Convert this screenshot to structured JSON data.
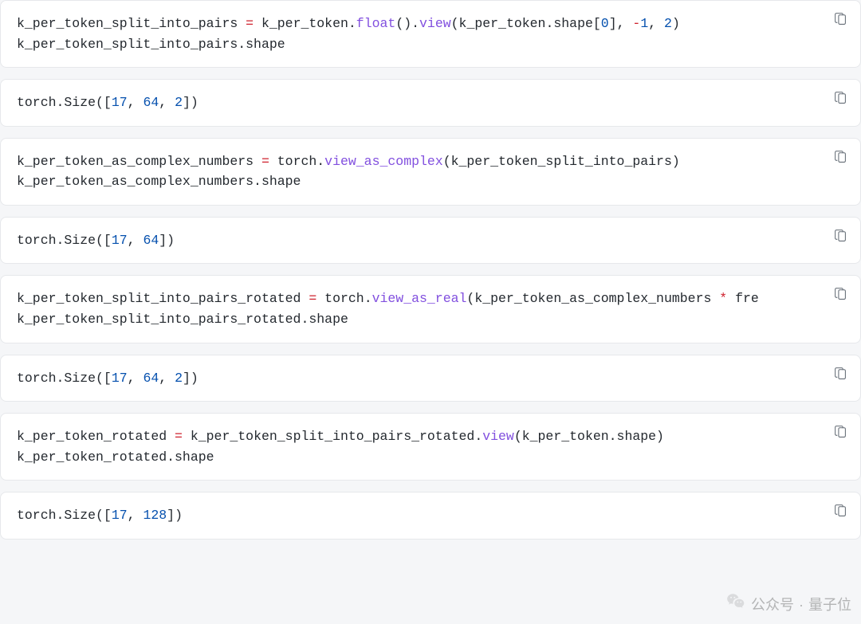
{
  "cells": [
    {
      "type": "code",
      "tokens": [
        {
          "t": "k_per_token_split_into_pairs ",
          "c": "id"
        },
        {
          "t": "=",
          "c": "op"
        },
        {
          "t": " k_per_token.",
          "c": "id"
        },
        {
          "t": "float",
          "c": "fn"
        },
        {
          "t": "().",
          "c": "id"
        },
        {
          "t": "view",
          "c": "fn"
        },
        {
          "t": "(k_per_token.shape[",
          "c": "id"
        },
        {
          "t": "0",
          "c": "num"
        },
        {
          "t": "], ",
          "c": "id"
        },
        {
          "t": "-",
          "c": "op"
        },
        {
          "t": "1",
          "c": "num"
        },
        {
          "t": ", ",
          "c": "id"
        },
        {
          "t": "2",
          "c": "num"
        },
        {
          "t": ")\n",
          "c": "id"
        },
        {
          "t": "k_per_token_split_into_pairs.shape",
          "c": "id"
        }
      ]
    },
    {
      "type": "output",
      "tokens": [
        {
          "t": "torch.Size([",
          "c": "id"
        },
        {
          "t": "17",
          "c": "num"
        },
        {
          "t": ", ",
          "c": "id"
        },
        {
          "t": "64",
          "c": "num"
        },
        {
          "t": ", ",
          "c": "id"
        },
        {
          "t": "2",
          "c": "num"
        },
        {
          "t": "])",
          "c": "id"
        }
      ]
    },
    {
      "type": "code",
      "tokens": [
        {
          "t": "k_per_token_as_complex_numbers ",
          "c": "id"
        },
        {
          "t": "=",
          "c": "op"
        },
        {
          "t": " torch.",
          "c": "id"
        },
        {
          "t": "view_as_complex",
          "c": "fn"
        },
        {
          "t": "(k_per_token_split_into_pairs)\n",
          "c": "id"
        },
        {
          "t": "k_per_token_as_complex_numbers.shape",
          "c": "id"
        }
      ]
    },
    {
      "type": "output",
      "tokens": [
        {
          "t": "torch.Size([",
          "c": "id"
        },
        {
          "t": "17",
          "c": "num"
        },
        {
          "t": ", ",
          "c": "id"
        },
        {
          "t": "64",
          "c": "num"
        },
        {
          "t": "])",
          "c": "id"
        }
      ]
    },
    {
      "type": "code",
      "tokens": [
        {
          "t": "k_per_token_split_into_pairs_rotated ",
          "c": "id"
        },
        {
          "t": "=",
          "c": "op"
        },
        {
          "t": " torch.",
          "c": "id"
        },
        {
          "t": "view_as_real",
          "c": "fn"
        },
        {
          "t": "(k_per_token_as_complex_numbers ",
          "c": "id"
        },
        {
          "t": "*",
          "c": "op"
        },
        {
          "t": " fre\n",
          "c": "id"
        },
        {
          "t": "k_per_token_split_into_pairs_rotated.shape",
          "c": "id"
        }
      ]
    },
    {
      "type": "output",
      "tokens": [
        {
          "t": "torch.Size([",
          "c": "id"
        },
        {
          "t": "17",
          "c": "num"
        },
        {
          "t": ", ",
          "c": "id"
        },
        {
          "t": "64",
          "c": "num"
        },
        {
          "t": ", ",
          "c": "id"
        },
        {
          "t": "2",
          "c": "num"
        },
        {
          "t": "])",
          "c": "id"
        }
      ]
    },
    {
      "type": "code",
      "tokens": [
        {
          "t": "k_per_token_rotated ",
          "c": "id"
        },
        {
          "t": "=",
          "c": "op"
        },
        {
          "t": " k_per_token_split_into_pairs_rotated.",
          "c": "id"
        },
        {
          "t": "view",
          "c": "fn"
        },
        {
          "t": "(k_per_token.shape)\n",
          "c": "id"
        },
        {
          "t": "k_per_token_rotated.shape",
          "c": "id"
        }
      ]
    },
    {
      "type": "output",
      "tokens": [
        {
          "t": "torch.Size([",
          "c": "id"
        },
        {
          "t": "17",
          "c": "num"
        },
        {
          "t": ", ",
          "c": "id"
        },
        {
          "t": "128",
          "c": "num"
        },
        {
          "t": "])",
          "c": "id"
        }
      ]
    }
  ],
  "watermark": {
    "label": "公众号",
    "sep": "·",
    "name": "量子位"
  }
}
